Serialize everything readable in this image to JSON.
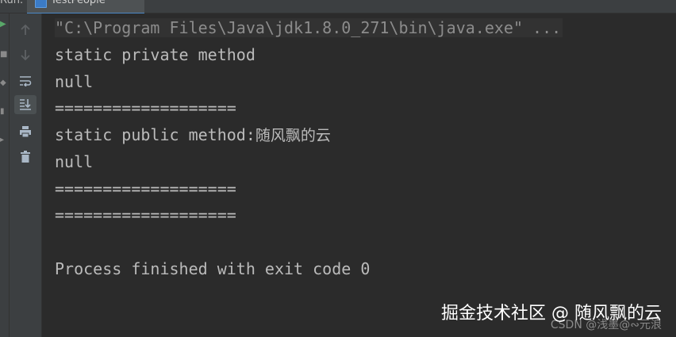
{
  "header": {
    "run_label": "Run:",
    "tab_label": "TestPeople"
  },
  "toolbar": {
    "icons": [
      "up-arrow-icon",
      "down-arrow-icon",
      "soft-wrap-icon",
      "scroll-to-end-icon",
      "print-icon",
      "trash-icon"
    ]
  },
  "console": {
    "lines": [
      "\"C:\\Program Files\\Java\\jdk1.8.0_271\\bin\\java.exe\" ...",
      "static private method",
      "null",
      "===================",
      "static public method:",
      "随风飘的云",
      "null",
      "===================",
      "===================",
      "Process finished with exit code 0"
    ]
  },
  "watermark": {
    "main": "掘金技术社区 @ 随风飘的云",
    "sub": "CSDN @浅墨@∾元浪"
  }
}
